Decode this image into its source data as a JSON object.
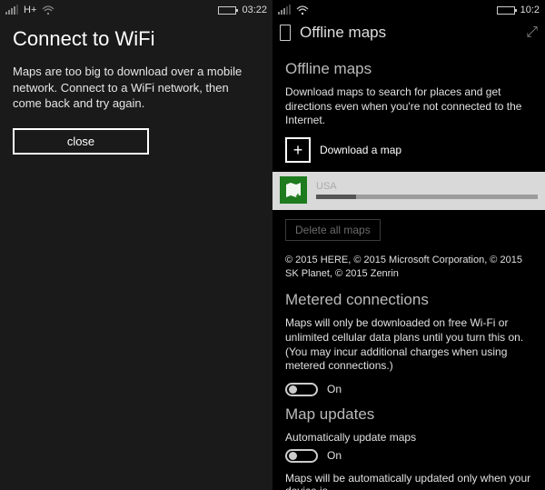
{
  "left": {
    "statusbar": {
      "data": "H+",
      "time": "03:22"
    },
    "title": "Connect to WiFi",
    "message": "Maps are too big to download over a mobile network. Connect to a WiFi network, then come back and try again.",
    "close_label": "close"
  },
  "right": {
    "statusbar": {
      "time": "10:2"
    },
    "header_title": "Offline maps",
    "sections": {
      "offline": {
        "title": "Offline maps",
        "desc": "Download maps to search for places and get directions even when you're not connected to the Internet.",
        "download_label": "Download a map",
        "map_item": {
          "name": "USA",
          "progress_pct": 18
        },
        "delete_label": "Delete all maps",
        "copyright": "© 2015 HERE, © 2015 Microsoft Corporation, © 2015 SK Planet, © 2015 Zenrin"
      },
      "metered": {
        "title": "Metered connections",
        "desc": "Maps will only be downloaded on free Wi-Fi or unlimited cellular data plans until you turn this on. (You may incur additional charges when using metered connections.)",
        "toggle_label": "On"
      },
      "updates": {
        "title": "Map updates",
        "sub": "Automatically update maps",
        "toggle_label": "On",
        "desc_cut": "Maps will be automatically updated only when your device is"
      }
    }
  }
}
